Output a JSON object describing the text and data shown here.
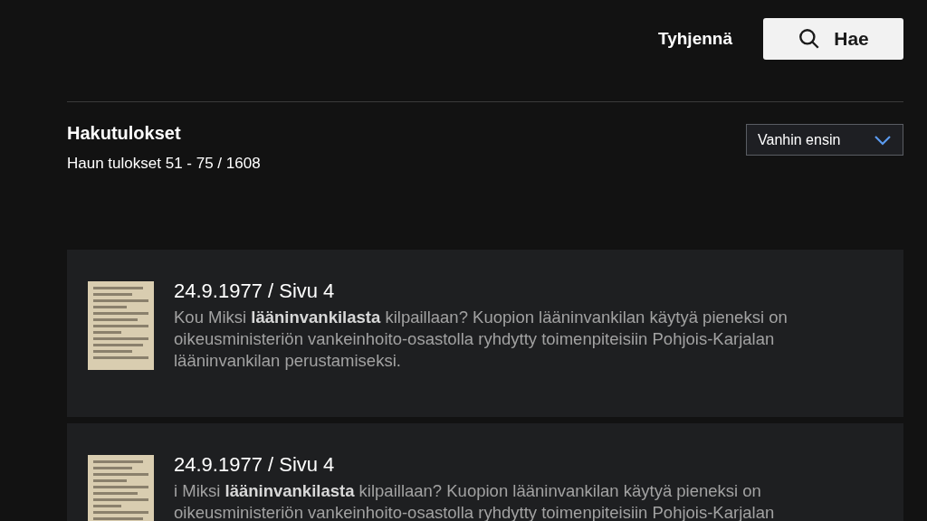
{
  "actions": {
    "clear": "Tyhjennä",
    "search": "Hae"
  },
  "results": {
    "title": "Hakutulokset",
    "summary": "Haun tulokset 51 - 75 / 1608",
    "sort": "Vanhin ensin"
  },
  "items": [
    {
      "heading": "24.9.1977 / Sivu 4",
      "snippet": "Kou Miksi **lääninvankilasta** kilpaillaan? Kuopion lääninvankilan käytyä pieneksi on oikeusministeriön vankeinhoito-osastolla ryhdytty toimenpiteisiin Pohjois-Karjalan lääninvankilan perustamiseksi."
    },
    {
      "heading": "24.9.1977 / Sivu 4",
      "snippet": "i Miksi **lääninvankilasta** kilpaillaan? Kuopion lääninvankilan käytyä pieneksi on oikeusministeriön vankeinhoito-osastolla ryhdytty toimenpiteisiin Pohjois-Karjalan"
    }
  ]
}
